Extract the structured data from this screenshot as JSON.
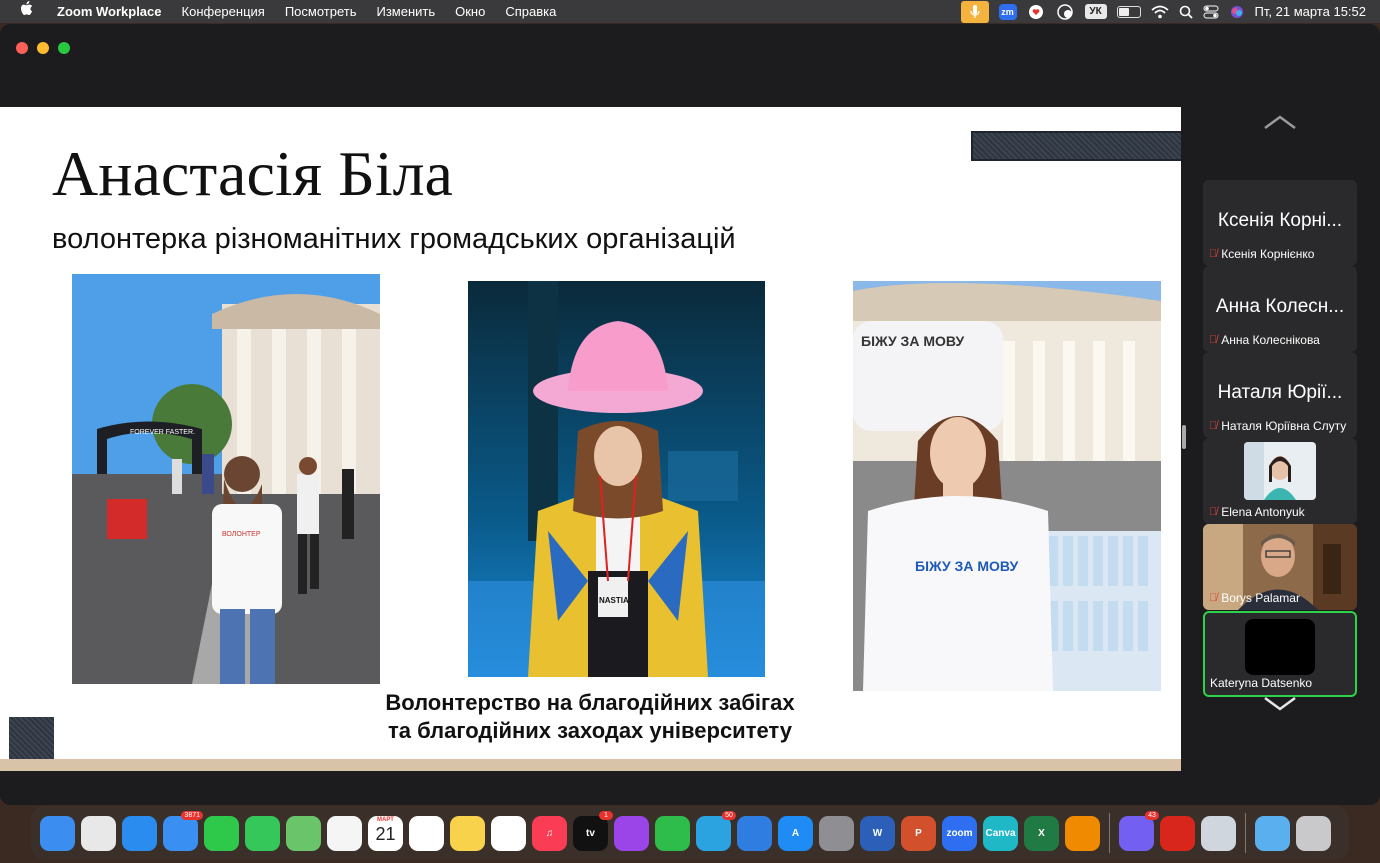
{
  "menubar": {
    "app_name": "Zoom Workplace",
    "menus": [
      "Конференция",
      "Посмотреть",
      "Изменить",
      "Окно",
      "Справка"
    ],
    "status": {
      "zoom_badge": "zm",
      "keyboard_layout": "УК",
      "clock": "Пт, 21 марта  15:52"
    },
    "icons": [
      "apple-icon",
      "microphone-icon",
      "zoom-icon",
      "heart-chat-icon",
      "timer-icon",
      "battery-icon",
      "wifi-icon",
      "search-icon",
      "control-center-icon",
      "siri-icon"
    ]
  },
  "slide": {
    "title": "Анастасія Біла",
    "subtitle": "волонтерка різноманітних громадських організацій",
    "caption_line1": "Волонтерство на благодійних забігах",
    "caption_line2": "та благодійних заходах університету",
    "photo2_badge": "NASTIA",
    "photo3_banner": "БІЖУ ЗА МОВУ",
    "photo3_shirt": "БІЖУ ЗА МОВУ",
    "photo1_arch": "FOREVER FASTER."
  },
  "participants": [
    {
      "display": "Ксенія Корні...",
      "name": "Ксенія Корнієнко",
      "muted": true,
      "video": false
    },
    {
      "display": "Анна Колесн...",
      "name": "Анна Колеснікова",
      "muted": true,
      "video": false
    },
    {
      "display": "Наталя Юрії...",
      "name": "Наталя Юріївна Слуту",
      "muted": true,
      "video": false
    },
    {
      "display": "",
      "name": "Elena Antonyuk",
      "muted": true,
      "video": true
    },
    {
      "display": "",
      "name": "Borys Palamar",
      "muted": true,
      "video": true
    },
    {
      "display": "",
      "name": "Kateryna Datsenko",
      "muted": false,
      "video": true,
      "active_speaker": true
    }
  ],
  "dock": {
    "apps": [
      {
        "name": "finder",
        "color": "#3b8df0",
        "label": ""
      },
      {
        "name": "launchpad",
        "color": "#e8e8e8",
        "label": ""
      },
      {
        "name": "safari",
        "color": "#2b8cf0",
        "label": ""
      },
      {
        "name": "mail",
        "color": "#3a8ff2",
        "label": "",
        "badge": "3871"
      },
      {
        "name": "facetime",
        "color": "#2ec84a",
        "label": ""
      },
      {
        "name": "messages",
        "color": "#35c759",
        "label": ""
      },
      {
        "name": "maps",
        "color": "#6ac46a",
        "label": ""
      },
      {
        "name": "photos",
        "color": "#f5f5f5",
        "label": ""
      },
      {
        "name": "calendar",
        "color": "#ffffff",
        "label": "",
        "month": "МАРТ",
        "day": "21"
      },
      {
        "name": "reminders",
        "color": "#ffffff",
        "label": ""
      },
      {
        "name": "notes",
        "color": "#f7d24a",
        "label": ""
      },
      {
        "name": "freeform",
        "color": "#ffffff",
        "label": ""
      },
      {
        "name": "music",
        "color": "#fa3c55",
        "label": "♫"
      },
      {
        "name": "apple-tv",
        "color": "#111111",
        "label": "tv",
        "badge": "1"
      },
      {
        "name": "podcasts",
        "color": "#9b44e8",
        "label": ""
      },
      {
        "name": "numbers",
        "color": "#2ebd4a",
        "label": ""
      },
      {
        "name": "telegram",
        "color": "#2aa3e0",
        "label": "",
        "badge": "50"
      },
      {
        "name": "keynote",
        "color": "#2f7de0",
        "label": ""
      },
      {
        "name": "app-store",
        "color": "#1f8cf5",
        "label": "A"
      },
      {
        "name": "system-settings",
        "color": "#8e8e93",
        "label": ""
      },
      {
        "name": "word",
        "color": "#2b5fb8",
        "label": "W"
      },
      {
        "name": "powerpoint",
        "color": "#d2502c",
        "label": "P"
      },
      {
        "name": "zoom",
        "color": "#2d6ff0",
        "label": "zoom"
      },
      {
        "name": "canva",
        "color": "#1fb8c7",
        "label": "Canva"
      },
      {
        "name": "excel",
        "color": "#1f7a43",
        "label": "X"
      },
      {
        "name": "vlc",
        "color": "#f08a00",
        "label": ""
      }
    ],
    "apps_right": [
      {
        "name": "viber",
        "color": "#7360f2",
        "label": "",
        "badge": "43"
      },
      {
        "name": "adobe-acrobat",
        "color": "#d9261c",
        "label": ""
      },
      {
        "name": "preview",
        "color": "#cfd6de",
        "label": ""
      }
    ],
    "apps_far": [
      {
        "name": "downloads-folder",
        "color": "#5ab0ef",
        "label": ""
      },
      {
        "name": "trash",
        "color": "#c9c9cc",
        "label": ""
      }
    ]
  }
}
